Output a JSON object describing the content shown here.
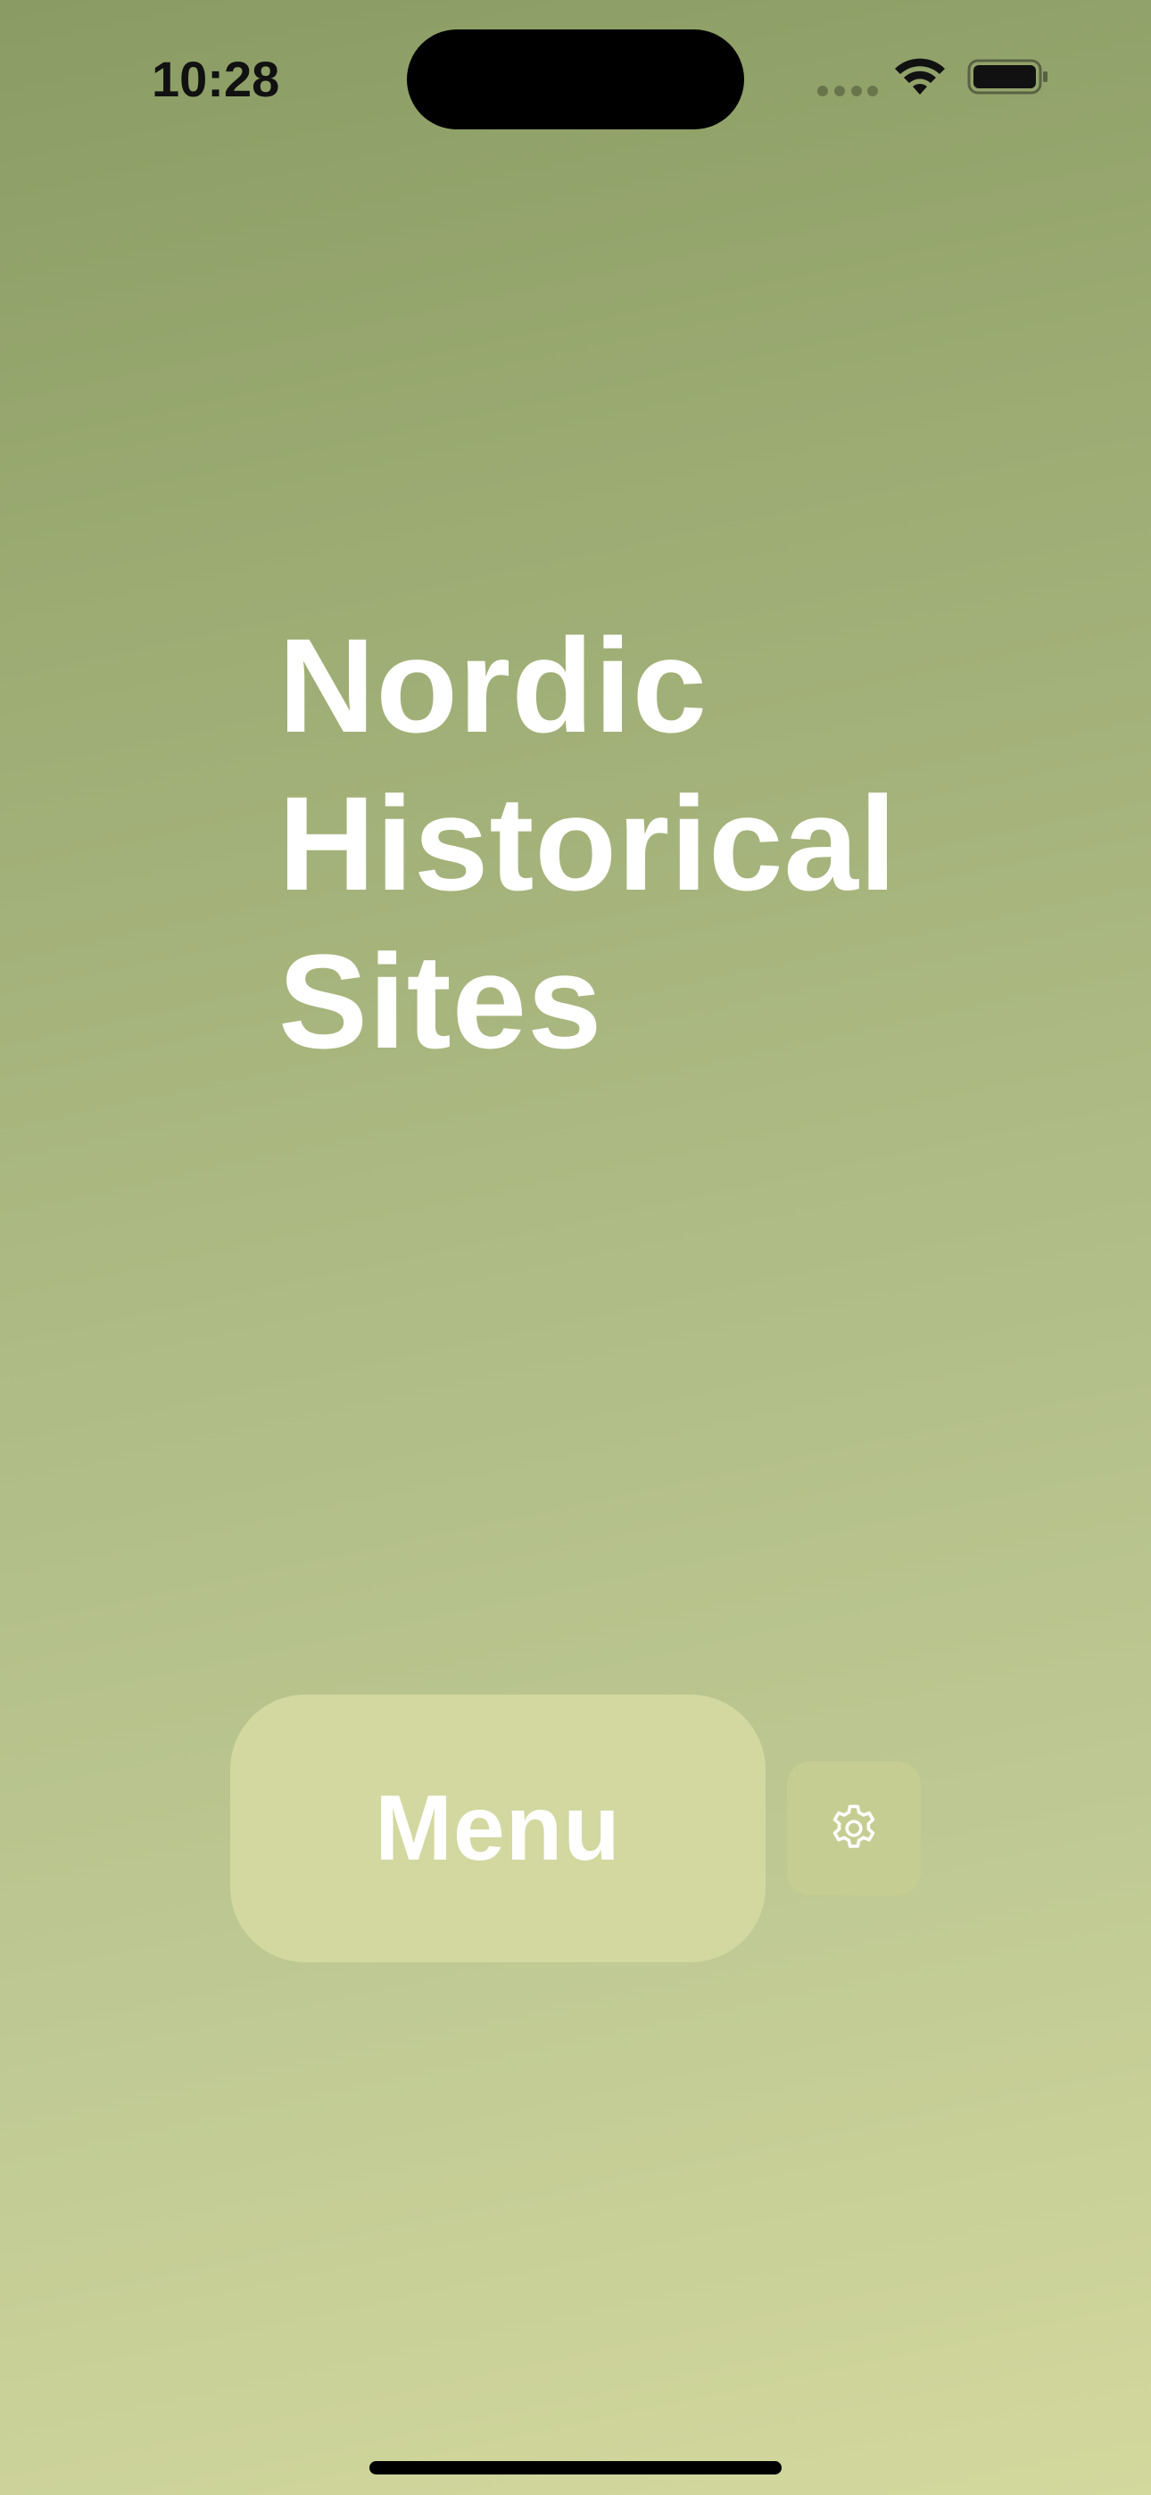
{
  "status_bar": {
    "time": "10:28"
  },
  "icons": {
    "wifi": "wifi-icon",
    "battery": "battery-icon",
    "cellular": "cellular-signal-icon",
    "settings": "gear-icon"
  },
  "main": {
    "title_lines": [
      "Nordic",
      "Historical",
      "Sites"
    ],
    "menu_button_label": "Menu"
  },
  "colors": {
    "background_top": "#8a9c64",
    "background_bottom": "#d3d89d",
    "menu_button": "#d2d89f",
    "settings_button": "#c6cd92",
    "text": "#ffffff"
  }
}
